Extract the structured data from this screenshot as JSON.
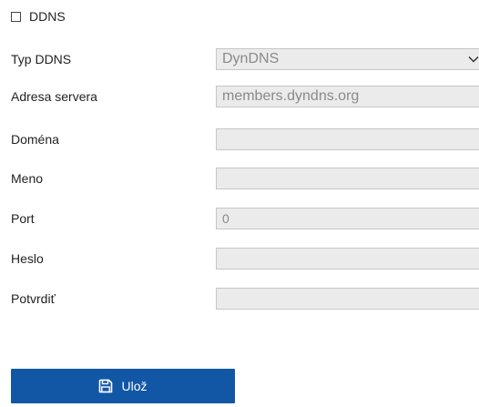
{
  "ddns": {
    "label": "DDNS",
    "checked": false
  },
  "fields": {
    "ddns_type": {
      "label": "Typ DDNS",
      "value": "DynDNS",
      "control": "select",
      "icon": "chevron-down-icon"
    },
    "server_address": {
      "label": "Adresa servera",
      "value": "members.dyndns.org"
    },
    "domain": {
      "label": "Doména",
      "value": ""
    },
    "username": {
      "label": "Meno",
      "value": ""
    },
    "port": {
      "label": "Port",
      "value": "0"
    },
    "password": {
      "label": "Heslo",
      "value": ""
    },
    "confirm": {
      "label": "Potvrdiť",
      "value": ""
    }
  },
  "save_button": {
    "label": "Ulož",
    "icon": "save-icon"
  },
  "colors": {
    "button_bg": "#1257a6",
    "field_bg": "#ebebeb",
    "field_border": "#c6c6c6",
    "field_text": "#8a8a8a"
  }
}
